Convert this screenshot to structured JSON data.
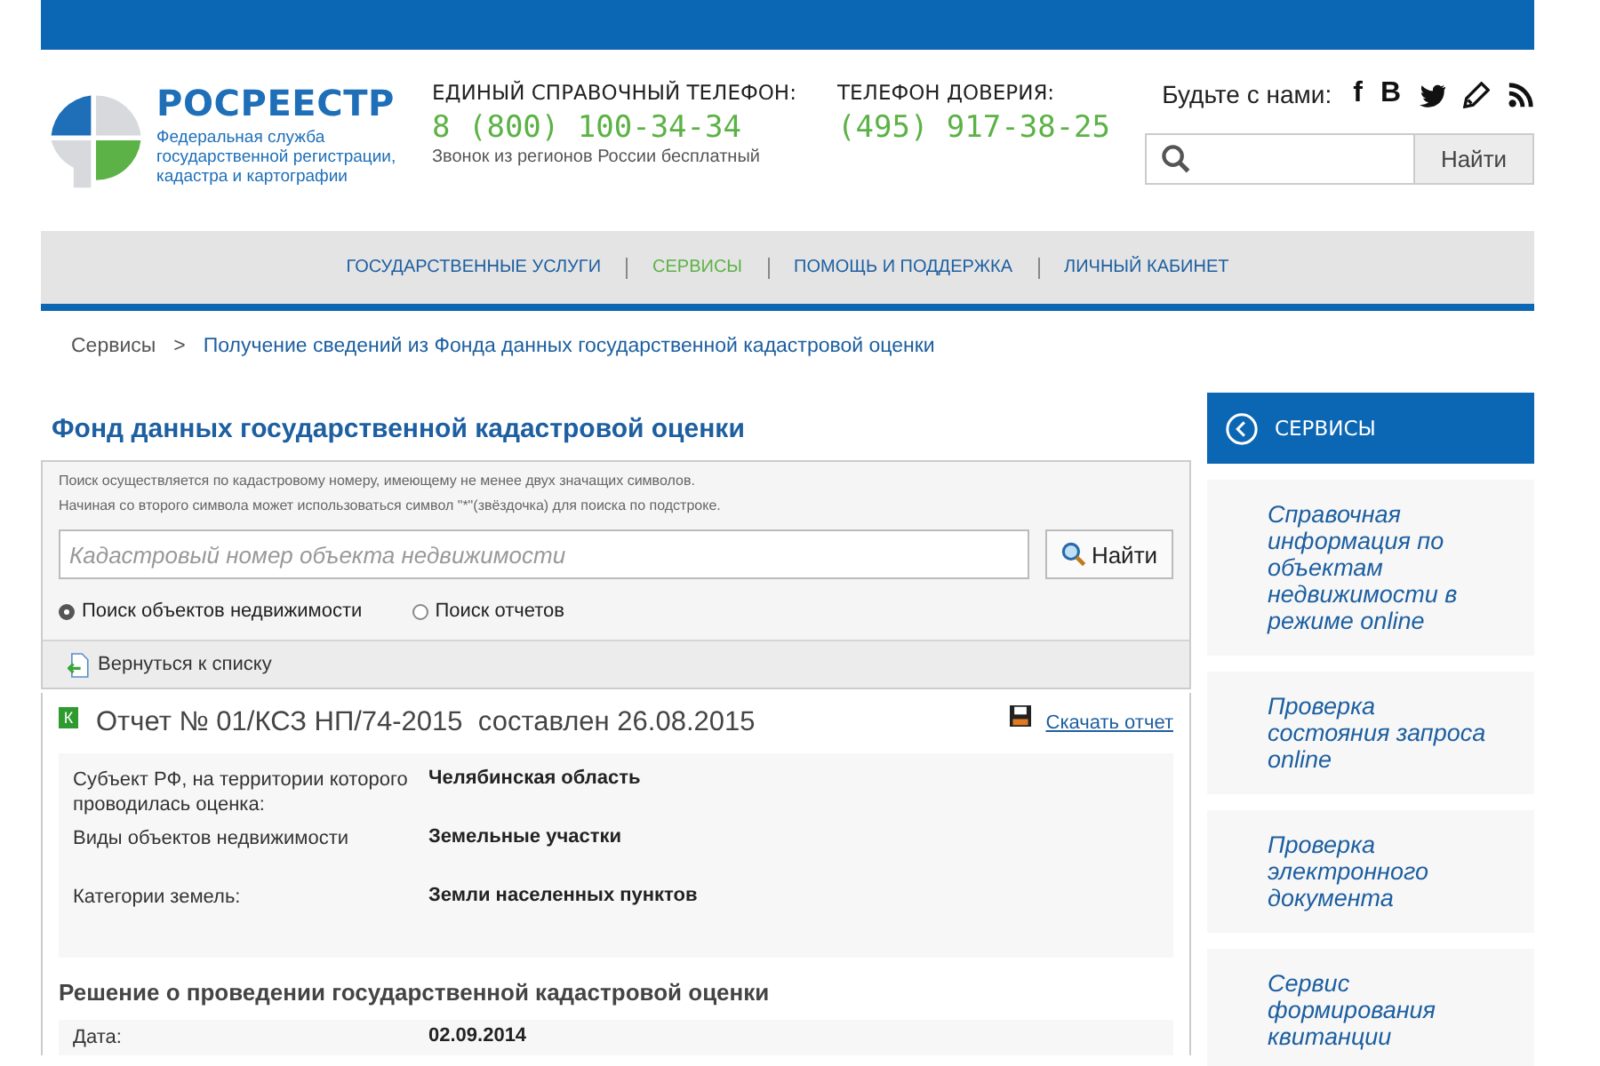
{
  "header": {
    "brand": "РОСРЕЕСТР",
    "brand_subtitle": "Федеральная служба государственной регистрации, кадастра и картографии",
    "hotline": {
      "label": "ЕДИНЫЙ СПРАВОЧНЫЙ ТЕЛЕФОН:",
      "number": "8 (800) 100-34-34",
      "note": "Звонок из регионов России бесплатный"
    },
    "trust_line": {
      "label": "ТЕЛЕФОН ДОВЕРИЯ:",
      "number": "(495) 917-38-25"
    },
    "social": {
      "label": "Будьте с нами:",
      "links": [
        {
          "kind": "glyph",
          "text": "f"
        },
        {
          "kind": "glyph",
          "text": "В"
        },
        {
          "kind": "bird"
        },
        {
          "kind": "pencil"
        },
        {
          "kind": "rss"
        }
      ]
    },
    "search": {
      "button": "Найти"
    }
  },
  "nav": [
    {
      "label": "ГОСУДАРСТВЕННЫЕ УСЛУГИ",
      "selected": false
    },
    {
      "label": "СЕРВИСЫ",
      "selected": true
    },
    {
      "label": "ПОМОЩЬ И ПОДДЕРЖКА",
      "selected": false
    },
    {
      "label": "ЛИЧНЫЙ КАБИНЕТ",
      "selected": false
    }
  ],
  "breadcrumb": {
    "parent": "Сервисы",
    "separator": ">",
    "current": "Получение сведений из Фонда данных государственной кадастровой оценки"
  },
  "page_title": "Фонд данных государственной кадастровой оценки",
  "search_panel": {
    "hints": [
      "Поиск осуществляется по кадастровому номеру, имеющему не менее двух значащих символов.",
      "Начиная со второго символа может использоваться символ \"*\"(звёздочка) для поиска по подстроке."
    ],
    "placeholder": "Кадастровый номер объекта недвижимости",
    "button": "Найти",
    "modes": [
      {
        "label": "Поиск объектов недвижимости",
        "selected": true
      },
      {
        "label": "Поиск отчетов",
        "selected": false
      }
    ],
    "back_link": "Вернуться к списку"
  },
  "report": {
    "badge": "К",
    "title": "Отчет № 01/КСЗ НП/74-2015  составлен 26.08.2015",
    "download": "Скачать отчет",
    "details": [
      {
        "label": "Субъект РФ, на территории которого проводилась оценка:",
        "value": "Челябинская область"
      },
      {
        "label": "Виды объектов недвижимости",
        "value": "Земельные участки"
      },
      {
        "label": "Категории земель:",
        "value": "Земли населенных пунктов"
      }
    ],
    "decision_title": "Решение о проведении государственной кадастровой оценки",
    "decision_details": [
      {
        "label": "Дата:",
        "value": "02.09.2014"
      }
    ]
  },
  "sidebar": {
    "title": "СЕРВИСЫ",
    "items": [
      "Справочная информация по объектам недвижимости в режиме online",
      "Проверка состояния запроса online",
      "Проверка электронного документа",
      "Сервис формирования квитанции"
    ]
  }
}
